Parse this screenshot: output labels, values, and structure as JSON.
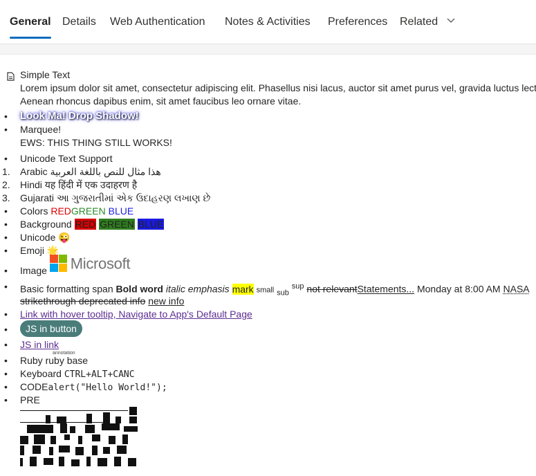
{
  "tabs": [
    {
      "label": "General",
      "active": true
    },
    {
      "label": "Details"
    },
    {
      "label": "Web Authentication"
    },
    {
      "label": "Notes & Activities"
    },
    {
      "label": "Preferences"
    },
    {
      "label": "Related",
      "dropdown": true
    }
  ],
  "content": {
    "simple_text": {
      "heading": "Simple Text",
      "line1": "Lorem ipsum dolor sit amet, consectetur adipiscing elit. Phasellus nisi lacus, auctor sit amet purus vel, gravida luctus lectus.",
      "line2": "Aenean rhoncus dapibus enim, sit amet faucibus leo ornare vitae."
    },
    "drop_shadow": "Look Ma! Drop Shadow!",
    "marquee": "Marquee!",
    "marquee_sub": "EWS: THIS THING STILL WORKS!",
    "unicode_support": "Unicode Text Support",
    "languages": [
      {
        "num": "1.",
        "name": "Arabic",
        "text": "هذا مثال للنص باللغة العربية"
      },
      {
        "num": "2.",
        "name": "Hindi",
        "text": "यह हिंदी में एक उदाहरण है"
      },
      {
        "num": "3.",
        "name": "Gujarati",
        "text": "આ ગુજરાતીમાં એક ઉદાહરણ લખાણ છે"
      }
    ],
    "colors": {
      "label": "Colors",
      "red": "RED",
      "green": "GREEN",
      "blue": "BLUE"
    },
    "background": {
      "label": "Background",
      "red": "RED",
      "green": "GREEN",
      "blue": "BLUE"
    },
    "unicode": {
      "label": "Unicode",
      "glyph": "😜"
    },
    "emoji": {
      "label": "Emoji",
      "glyph": "🌟"
    },
    "image": {
      "label": "Image",
      "logo_text": "Microsoft"
    },
    "formatting": {
      "label": "Basic formatting span",
      "bold": "Bold word",
      "italic": "italic emphasis",
      "mark": "mark",
      "small": "small",
      "sub": "sub",
      "sup": "sup",
      "not_relevant": "not relevant",
      "statements": "Statements...",
      "time": "Monday at 8:00 AM",
      "abbr": "NASA",
      "strikethrough": "strikethrough deprecated info",
      "new_info": "new info"
    },
    "hover_link": "Link with hover tooltip, Navigate to App's Default Page",
    "js_button": "JS in button",
    "js_link": "JS in link",
    "ruby": {
      "label": "Ruby",
      "base": "ruby base",
      "annotation": "annotation"
    },
    "keyboard": {
      "label": "Keyboard",
      "keys": "CTRL+ALT+CANC"
    },
    "code": {
      "label": "CODE",
      "code": "alert(\"Hello World!\");"
    },
    "pre": {
      "label": "PRE"
    }
  },
  "colors": {
    "accent": "#0f6cbd",
    "link": "#5c2d91",
    "button": "#4a7c7a"
  }
}
